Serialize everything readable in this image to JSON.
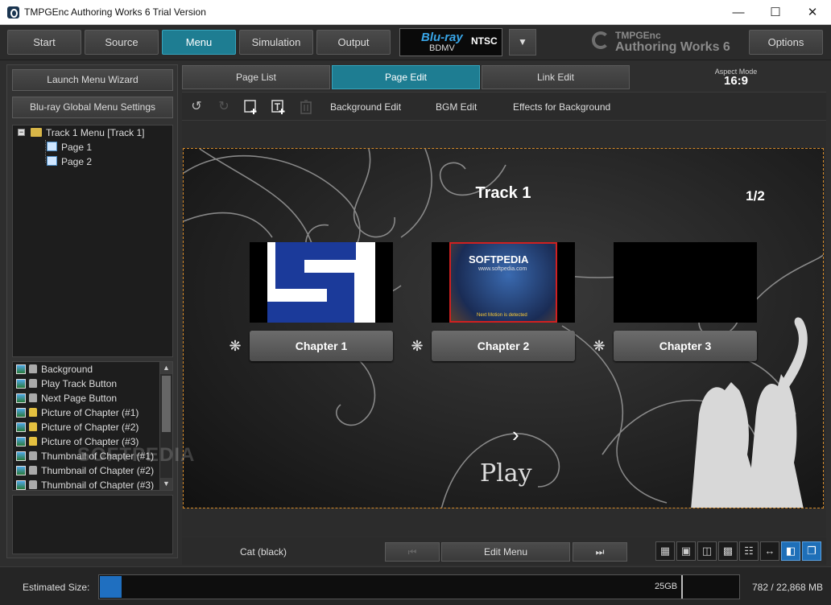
{
  "window": {
    "title": "TMPGEnc Authoring Works 6 Trial Version"
  },
  "topbar": {
    "steps": [
      "Start",
      "Source",
      "Menu",
      "Simulation",
      "Output"
    ],
    "active_step": "Menu",
    "format": {
      "logo": "Blu-ray",
      "sub": "BDMV",
      "standard": "NTSC"
    },
    "brand_line1": "TMPGEnc",
    "brand_line2": "Authoring Works 6",
    "options_label": "Options"
  },
  "left": {
    "wizard_label": "Launch Menu Wizard",
    "global_label": "Blu-ray Global Menu Settings",
    "tree": {
      "root": "Track 1 Menu [Track 1]",
      "pages": [
        "Page 1",
        "Page 2"
      ],
      "selected": "Page 1"
    },
    "layers": [
      {
        "label": "Background",
        "locked": false
      },
      {
        "label": "Play Track Button",
        "locked": false
      },
      {
        "label": "Next Page Button",
        "locked": false
      },
      {
        "label": "Picture of Chapter (#1)",
        "locked": true
      },
      {
        "label": "Picture of Chapter (#2)",
        "locked": true
      },
      {
        "label": "Picture of Chapter (#3)",
        "locked": true
      },
      {
        "label": "Thumbnail of Chapter (#1)",
        "locked": false
      },
      {
        "label": "Thumbnail of Chapter (#2)",
        "locked": false
      },
      {
        "label": "Thumbnail of Chapter (#3)",
        "locked": false
      }
    ]
  },
  "tabs": [
    "Page List",
    "Page Edit",
    "Link Edit"
  ],
  "active_tab": "Page Edit",
  "aspect": {
    "label": "Aspect Mode",
    "value": "16:9"
  },
  "toolbar": {
    "links": [
      "Background Edit",
      "BGM Edit",
      "Effects for Background"
    ]
  },
  "menu_page": {
    "title": "Track 1",
    "page_indicator": "1/2",
    "chapters": [
      "Chapter 1",
      "Chapter 2",
      "Chapter 3"
    ],
    "thumb2_text": "SOFTPEDIA",
    "thumb2_sub": "www.softpedia.com",
    "thumb2_caption": "Next Motion is detected",
    "play_label": "Play",
    "watermark": "SOFTPEDIA"
  },
  "bottom": {
    "template_name": "Cat (black)",
    "edit_menu_label": "Edit Menu"
  },
  "status": {
    "label": "Estimated Size:",
    "capacity_label": "25GB",
    "used_fraction": 0.034,
    "value": "782 / 22,868 MB"
  },
  "colors": {
    "accent": "#1e7d92",
    "progress": "#1f6fc0",
    "selection_outline": "#d68b2a"
  }
}
